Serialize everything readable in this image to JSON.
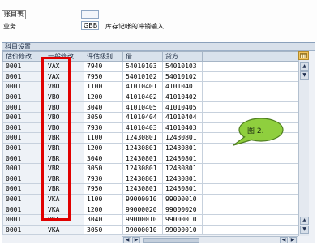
{
  "header": {
    "title_label": "账目表",
    "business_label": "业务",
    "business_code": "GBB",
    "business_desc": "库存记帐的冲销输入"
  },
  "panel": {
    "title": "科目设置"
  },
  "table": {
    "columns": [
      "估价修改",
      "一般修改",
      "评估级别",
      "借",
      "贷方"
    ],
    "rows": [
      [
        "0001",
        "VAX",
        "7940",
        "54010103",
        "54010103"
      ],
      [
        "0001",
        "VAX",
        "7950",
        "54010102",
        "54010102"
      ],
      [
        "0001",
        "VBO",
        "1100",
        "41010401",
        "41010401"
      ],
      [
        "0001",
        "VBO",
        "1200",
        "41010402",
        "41010402"
      ],
      [
        "0001",
        "VBO",
        "3040",
        "41010405",
        "41010405"
      ],
      [
        "0001",
        "VBO",
        "3050",
        "41010404",
        "41010404"
      ],
      [
        "0001",
        "VBO",
        "7930",
        "41010403",
        "41010403"
      ],
      [
        "0001",
        "VBR",
        "1100",
        "12430801",
        "12430801"
      ],
      [
        "0001",
        "VBR",
        "1200",
        "12430801",
        "12430801"
      ],
      [
        "0001",
        "VBR",
        "3040",
        "12430801",
        "12430801"
      ],
      [
        "0001",
        "VBR",
        "3050",
        "12430801",
        "12430801"
      ],
      [
        "0001",
        "VBR",
        "7930",
        "12430801",
        "12430801"
      ],
      [
        "0001",
        "VBR",
        "7950",
        "12430801",
        "12430801"
      ],
      [
        "0001",
        "VKA",
        "1100",
        "99000010",
        "99000010"
      ],
      [
        "0001",
        "VKA",
        "1200",
        "99000020",
        "99000020"
      ],
      [
        "0001",
        "VKA",
        "3040",
        "99000010",
        "99000010"
      ],
      [
        "0001",
        "VKA",
        "3050",
        "99000010",
        "99000010"
      ]
    ]
  },
  "annotation": {
    "callout_text": "图 2."
  },
  "colors": {
    "highlight": "#e00000",
    "callout_fill": "#8fcf3e",
    "header_bg": "#d9e2ec"
  },
  "icons": {
    "config": "grid-settings-icon",
    "scroll_up": "arrow-up-icon",
    "scroll_down": "arrow-down-icon",
    "scroll_left": "arrow-left-icon",
    "scroll_right": "arrow-right-icon"
  }
}
